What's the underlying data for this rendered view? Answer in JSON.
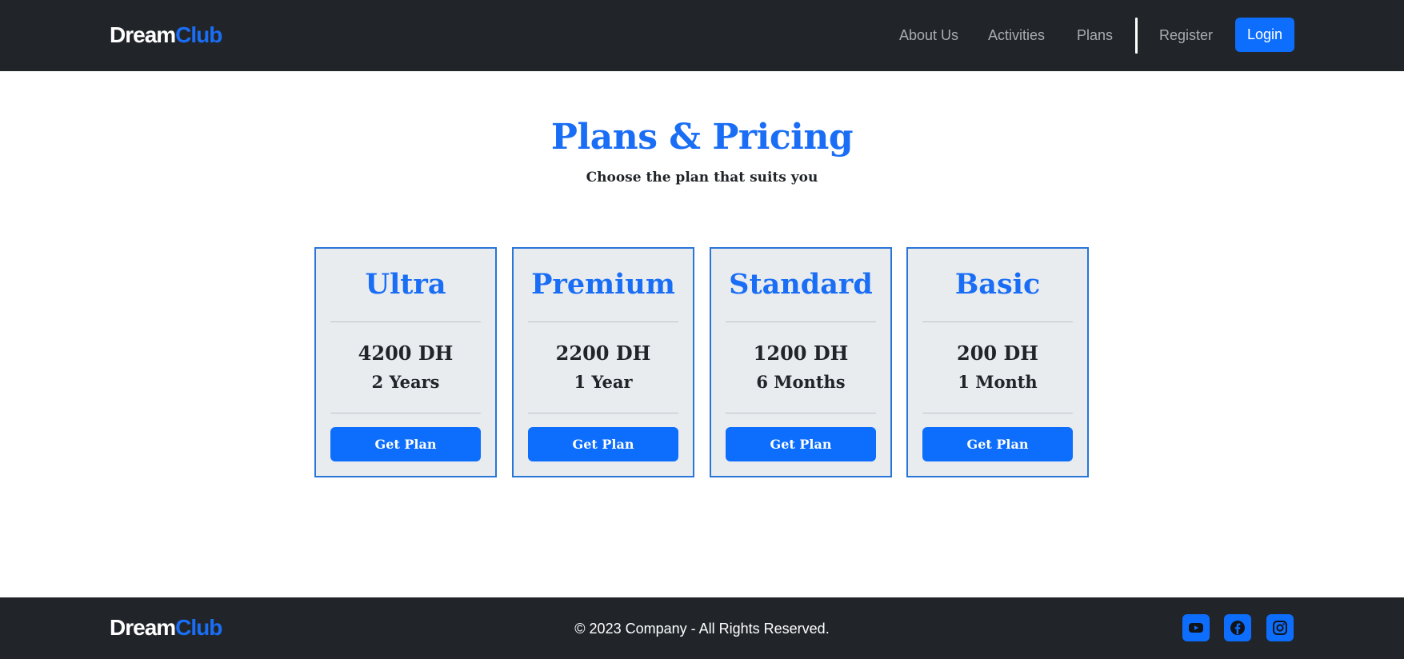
{
  "brand": {
    "part1": "Dream",
    "part2": "Club"
  },
  "nav": {
    "links": [
      "About Us",
      "Activities",
      "Plans",
      "Register"
    ],
    "login_label": "Login"
  },
  "hero": {
    "title": "Plans & Pricing",
    "subtitle": "Choose the plan that suits you"
  },
  "plans": [
    {
      "name": "Ultra",
      "price": "4200 DH",
      "duration": "2 Years",
      "button": "Get Plan"
    },
    {
      "name": "Premium",
      "price": "2200 DH",
      "duration": "1 Year",
      "button": "Get Plan"
    },
    {
      "name": "Standard",
      "price": "1200 DH",
      "duration": "6 Months",
      "button": "Get Plan"
    },
    {
      "name": "Basic",
      "price": "200 DH",
      "duration": "1 Month",
      "button": "Get Plan"
    }
  ],
  "footer": {
    "copyright": "© 2023 Company - All Rights Reserved.",
    "social_icons": [
      "youtube-icon",
      "facebook-icon",
      "instagram-icon"
    ]
  },
  "colors": {
    "accent": "#0d6efd",
    "brand_blue": "#1a6ef5",
    "dark_bg": "#212529",
    "card_bg": "#e9ecef"
  }
}
